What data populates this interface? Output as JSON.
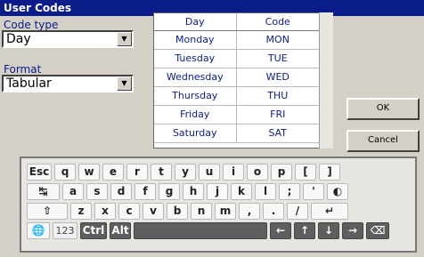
{
  "window": {
    "title": "User Codes"
  },
  "form": {
    "code_type_label": "Code type",
    "code_type_value": "Day",
    "format_label": "Format",
    "format_value": "Tabular"
  },
  "table": {
    "headers": [
      "Day",
      "Code"
    ],
    "rows": [
      [
        "Monday",
        "MON"
      ],
      [
        "Tuesday",
        "TUE"
      ],
      [
        "Wednesday",
        "WED"
      ],
      [
        "Thursday",
        "THU"
      ],
      [
        "Friday",
        "FRI"
      ],
      [
        "Saturday",
        "SAT"
      ]
    ]
  },
  "buttons": {
    "ok": "OK",
    "cancel": "Cancel"
  },
  "keyboard": {
    "row1": [
      "Esc",
      "q",
      "w",
      "e",
      "r",
      "t",
      "y",
      "u",
      "i",
      "o",
      "p",
      "[",
      "]"
    ],
    "row2": [
      "↹",
      "a",
      "s",
      "d",
      "f",
      "g",
      "h",
      "j",
      "k",
      "l",
      ";",
      "'",
      "◐"
    ],
    "row3": [
      "⇧",
      "z",
      "x",
      "c",
      "v",
      "b",
      "n",
      "m",
      ",",
      ".",
      "/",
      "↵"
    ],
    "row4": [
      "🌐",
      "123",
      "Ctrl",
      "Alt",
      "",
      "←",
      "↑",
      "↓",
      "→",
      "⌫"
    ]
  }
}
